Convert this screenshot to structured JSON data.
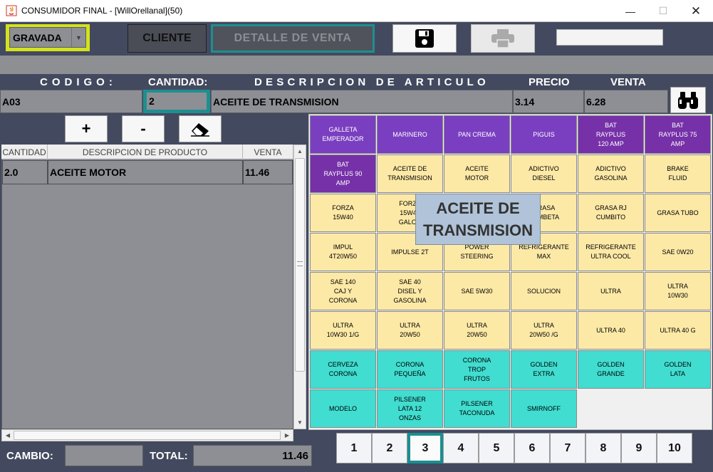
{
  "window": {
    "title": "CONSUMIDOR FINAL - [WillOrellanal](50)",
    "minimize": "—",
    "maximize": "☐",
    "close": "✕"
  },
  "toolbar": {
    "tax_type": "GRAVADA",
    "cliente_label": "CLIENTE",
    "detalle_label": "DETALLE DE VENTA",
    "save_icon": "save-icon",
    "print_icon": "print-icon",
    "search_value": ""
  },
  "headers": {
    "codigo": "CODIGO:",
    "cantidad": "CANTIDAD:",
    "descripcion": "DESCRIPCION DE ARTICULO",
    "precio": "PRECIO",
    "venta": "VENTA"
  },
  "entry": {
    "codigo": "A03",
    "cantidad": "2",
    "descripcion": "ACEITE DE TRANSMISION",
    "precio": "3.14",
    "venta": "6.28"
  },
  "tools": {
    "plus": "+",
    "minus": "-",
    "erase_icon": "eraser-icon"
  },
  "table": {
    "columns": [
      "CANTIDAD",
      "DESCRIPCION DE PRODUCTO",
      "VENTA"
    ],
    "rows": [
      {
        "cantidad": "2.0",
        "descripcion": "ACEITE MOTOR",
        "venta": "11.46"
      }
    ]
  },
  "totals": {
    "cambio_label": "CAMBIO:",
    "cambio_value": "",
    "total_label": "TOTAL:",
    "total_value": "11.46"
  },
  "tooltip": {
    "line1": "ACEITE DE",
    "line2": "TRANSMISION"
  },
  "products": [
    {
      "label": "GALLETA\nEMPERADOR",
      "color": "purple"
    },
    {
      "label": "MARINERO",
      "color": "purple"
    },
    {
      "label": "PAN CREMA",
      "color": "purple"
    },
    {
      "label": "PIGUIS",
      "color": "purple"
    },
    {
      "label": "BAT\nRAYPLUS\n120 AMP",
      "color": "purple dark"
    },
    {
      "label": "BAT\nRAYPLUS 75\nAMP",
      "color": "purple dark"
    },
    {
      "label": "BAT\nRAYPLUS 90\nAMP",
      "color": "purple dark"
    },
    {
      "label": "ACEITE DE\nTRANSMISION",
      "color": "yellow"
    },
    {
      "label": "ACEITE\nMOTOR",
      "color": "yellow"
    },
    {
      "label": "ADICTIVO\nDIESEL",
      "color": "yellow"
    },
    {
      "label": "ADICTIVO\nGASOLINA",
      "color": "yellow"
    },
    {
      "label": "BRAKE\nFLUID",
      "color": "yellow"
    },
    {
      "label": "FORZA\n15W40",
      "color": "yellow"
    },
    {
      "label": "FORZA\n15W40\nGALON",
      "color": "yellow"
    },
    {
      "label": "GRASA\nBOMBETA",
      "color": "yellow"
    },
    {
      "label": "GRASA\nBOMBETA",
      "color": "yellow"
    },
    {
      "label": "GRASA RJ\nCUMBITO",
      "color": "yellow"
    },
    {
      "label": "GRASA TUBO",
      "color": "yellow"
    },
    {
      "label": "IMPUL\n4T20W50",
      "color": "yellow"
    },
    {
      "label": "IMPULSE 2T",
      "color": "yellow"
    },
    {
      "label": "POWER\nSTEERING",
      "color": "yellow"
    },
    {
      "label": "REFRIGERANTE\nMAX",
      "color": "yellow"
    },
    {
      "label": "REFRIGERANTE\nULTRA COOL",
      "color": "yellow"
    },
    {
      "label": "SAE 0W20",
      "color": "yellow"
    },
    {
      "label": "SAE 140\nCAJ Y\nCORONA",
      "color": "yellow"
    },
    {
      "label": "SAE 40\nDISEL Y\nGASOLINA",
      "color": "yellow"
    },
    {
      "label": "SAE 5W30",
      "color": "yellow"
    },
    {
      "label": "SOLUCION",
      "color": "yellow"
    },
    {
      "label": "ULTRA",
      "color": "yellow"
    },
    {
      "label": "ULTRA\n10W30",
      "color": "yellow"
    },
    {
      "label": "ULTRA\n10W30 1/G",
      "color": "yellow"
    },
    {
      "label": "ULTRA\n20W50",
      "color": "yellow"
    },
    {
      "label": "ULTRA\n20W50",
      "color": "yellow"
    },
    {
      "label": "ULTRA\n20W50 /G",
      "color": "yellow"
    },
    {
      "label": "ULTRA 40",
      "color": "yellow"
    },
    {
      "label": "ULTRA 40 G",
      "color": "yellow"
    },
    {
      "label": "CERVEZA\nCORONA",
      "color": "teal"
    },
    {
      "label": "CORONA\nPEQUEÑA",
      "color": "teal"
    },
    {
      "label": "CORONA\nTROP\nFRUTOS",
      "color": "teal"
    },
    {
      "label": "GOLDEN\nEXTRA",
      "color": "teal"
    },
    {
      "label": "GOLDEN\nGRANDE",
      "color": "teal"
    },
    {
      "label": "GOLDEN\nLATA",
      "color": "teal"
    },
    {
      "label": "MODELO",
      "color": "teal"
    },
    {
      "label": "PILSENER\nLATA 12\nONZAS",
      "color": "teal"
    },
    {
      "label": "PILSENER\nTACONUDA",
      "color": "teal"
    },
    {
      "label": "SMIRNOFF",
      "color": "teal"
    }
  ],
  "pages": [
    "1",
    "2",
    "3",
    "4",
    "5",
    "6",
    "7",
    "8",
    "9",
    "10"
  ],
  "selected_page": "3",
  "colors": {
    "background": "#434a5f",
    "accent_teal": "#1a8f91",
    "combo_highlight": "#d4e21c",
    "purple": "#7a3fc0",
    "yellow": "#fde9a6",
    "teal": "#40ddd0"
  }
}
